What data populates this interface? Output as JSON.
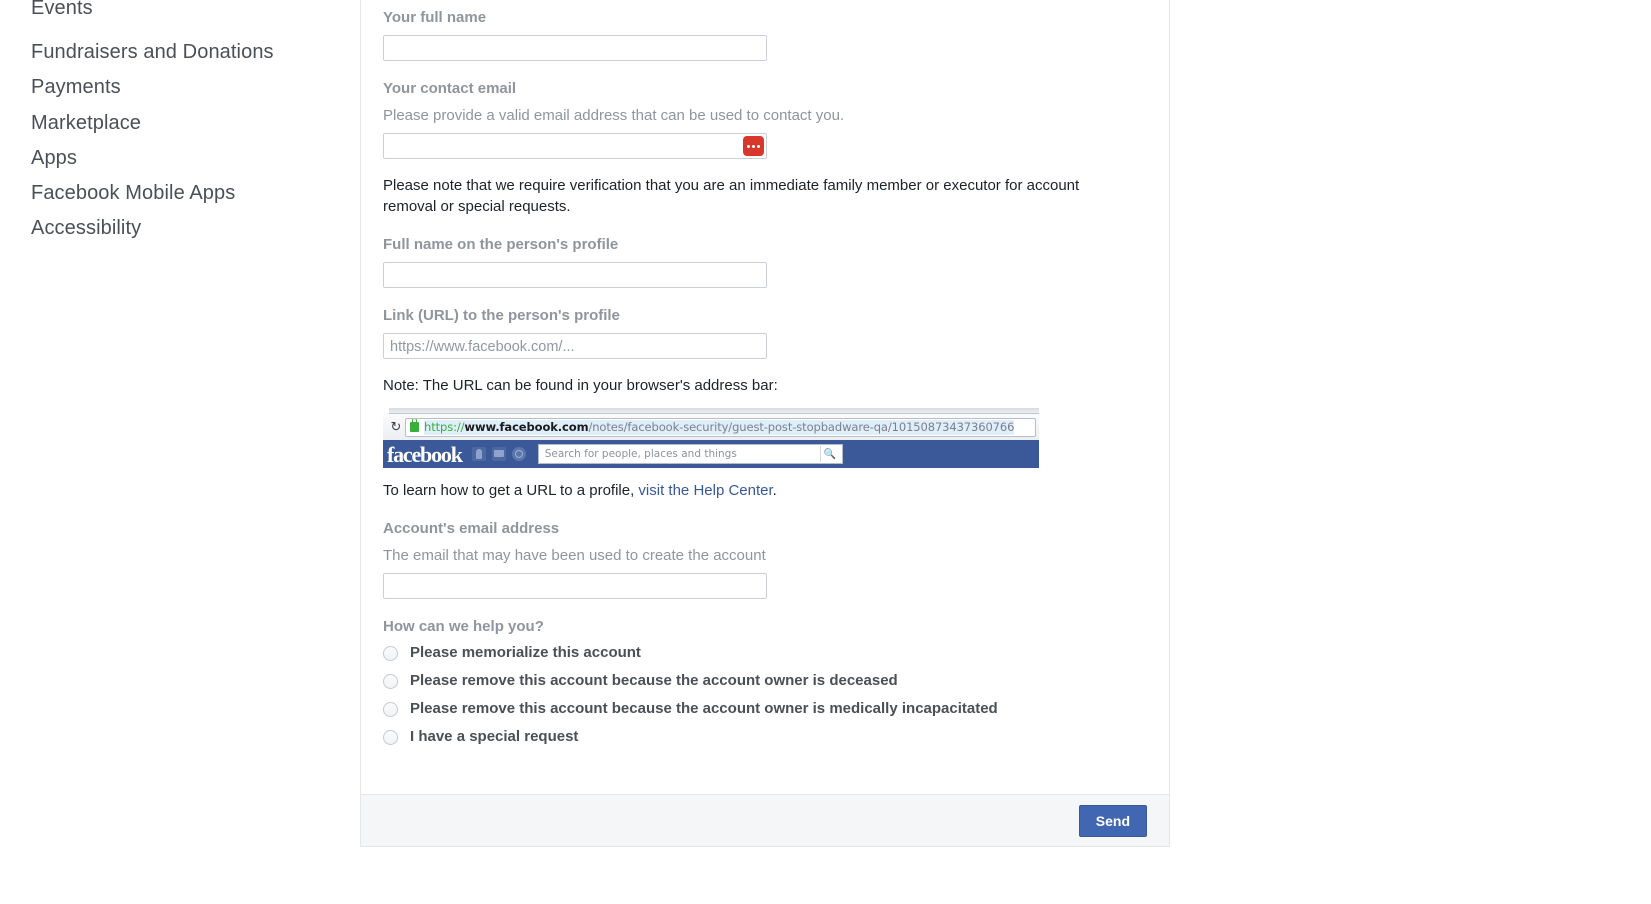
{
  "sidebar": {
    "items": [
      {
        "label": "Events"
      },
      {
        "label": "Fundraisers and Donations"
      },
      {
        "label": "Payments"
      },
      {
        "label": "Marketplace"
      },
      {
        "label": "Apps"
      },
      {
        "label": "Facebook Mobile Apps"
      },
      {
        "label": "Accessibility"
      }
    ]
  },
  "form": {
    "full_name": {
      "label": "Your full name",
      "value": "",
      "placeholder": ""
    },
    "contact_email": {
      "label": "Your contact email",
      "sublabel": "Please provide a valid email address that can be used to contact you.",
      "value": "",
      "placeholder": "",
      "password_manager_icon": "ellipsis-badge-icon",
      "password_manager_color": "#d9372b"
    },
    "verification_note": "Please note that we require verification that you are an immediate family member or executor for account removal or special requests.",
    "profile_name": {
      "label": "Full name on the person's profile",
      "value": "",
      "placeholder": ""
    },
    "profile_url": {
      "label": "Link (URL) to the person's profile",
      "value": "",
      "placeholder": "https://www.facebook.com/..."
    },
    "url_note": "Note: The URL can be found in your browser's address bar:",
    "help_text_before": "To learn how to get a URL to a profile, ",
    "help_link": "visit the Help Center",
    "help_text_after": ".",
    "account_email": {
      "label": "Account's email address",
      "sublabel": "The email that may have been used to create the account",
      "value": "",
      "placeholder": ""
    },
    "help_question": {
      "label": "How can we help you?",
      "options": [
        {
          "label": "Please memorialize this account",
          "selected": false
        },
        {
          "label": "Please remove this account because the account owner is deceased",
          "selected": false
        },
        {
          "label": "Please remove this account because the account owner is medically incapacitated",
          "selected": false
        },
        {
          "label": "I have a special request",
          "selected": false
        }
      ]
    },
    "submit_label": "Send"
  },
  "browser_screenshot": {
    "reload_icon": "reload-icon",
    "lock_icon": "padlock-icon",
    "url_scheme": "https://",
    "url_host": "www.facebook.com",
    "url_path": "/notes/facebook-security/guest-post-stopbadware-qa/10150873437360766",
    "site_logo": "facebook",
    "nav_icons": [
      "friend-requests-icon",
      "messages-icon",
      "notifications-icon"
    ],
    "search_placeholder": "Search for people, places and things",
    "search_icon": "search-icon",
    "navbar_color": "#3b5998"
  },
  "colors": {
    "brand_blue": "#3b5998",
    "button_blue": "#4267b2",
    "link_blue": "#365899",
    "label_gray": "#90949c",
    "text_dark": "#1d2129",
    "border_gray": "#e5e6e9",
    "footer_gray": "#f5f6f7"
  }
}
